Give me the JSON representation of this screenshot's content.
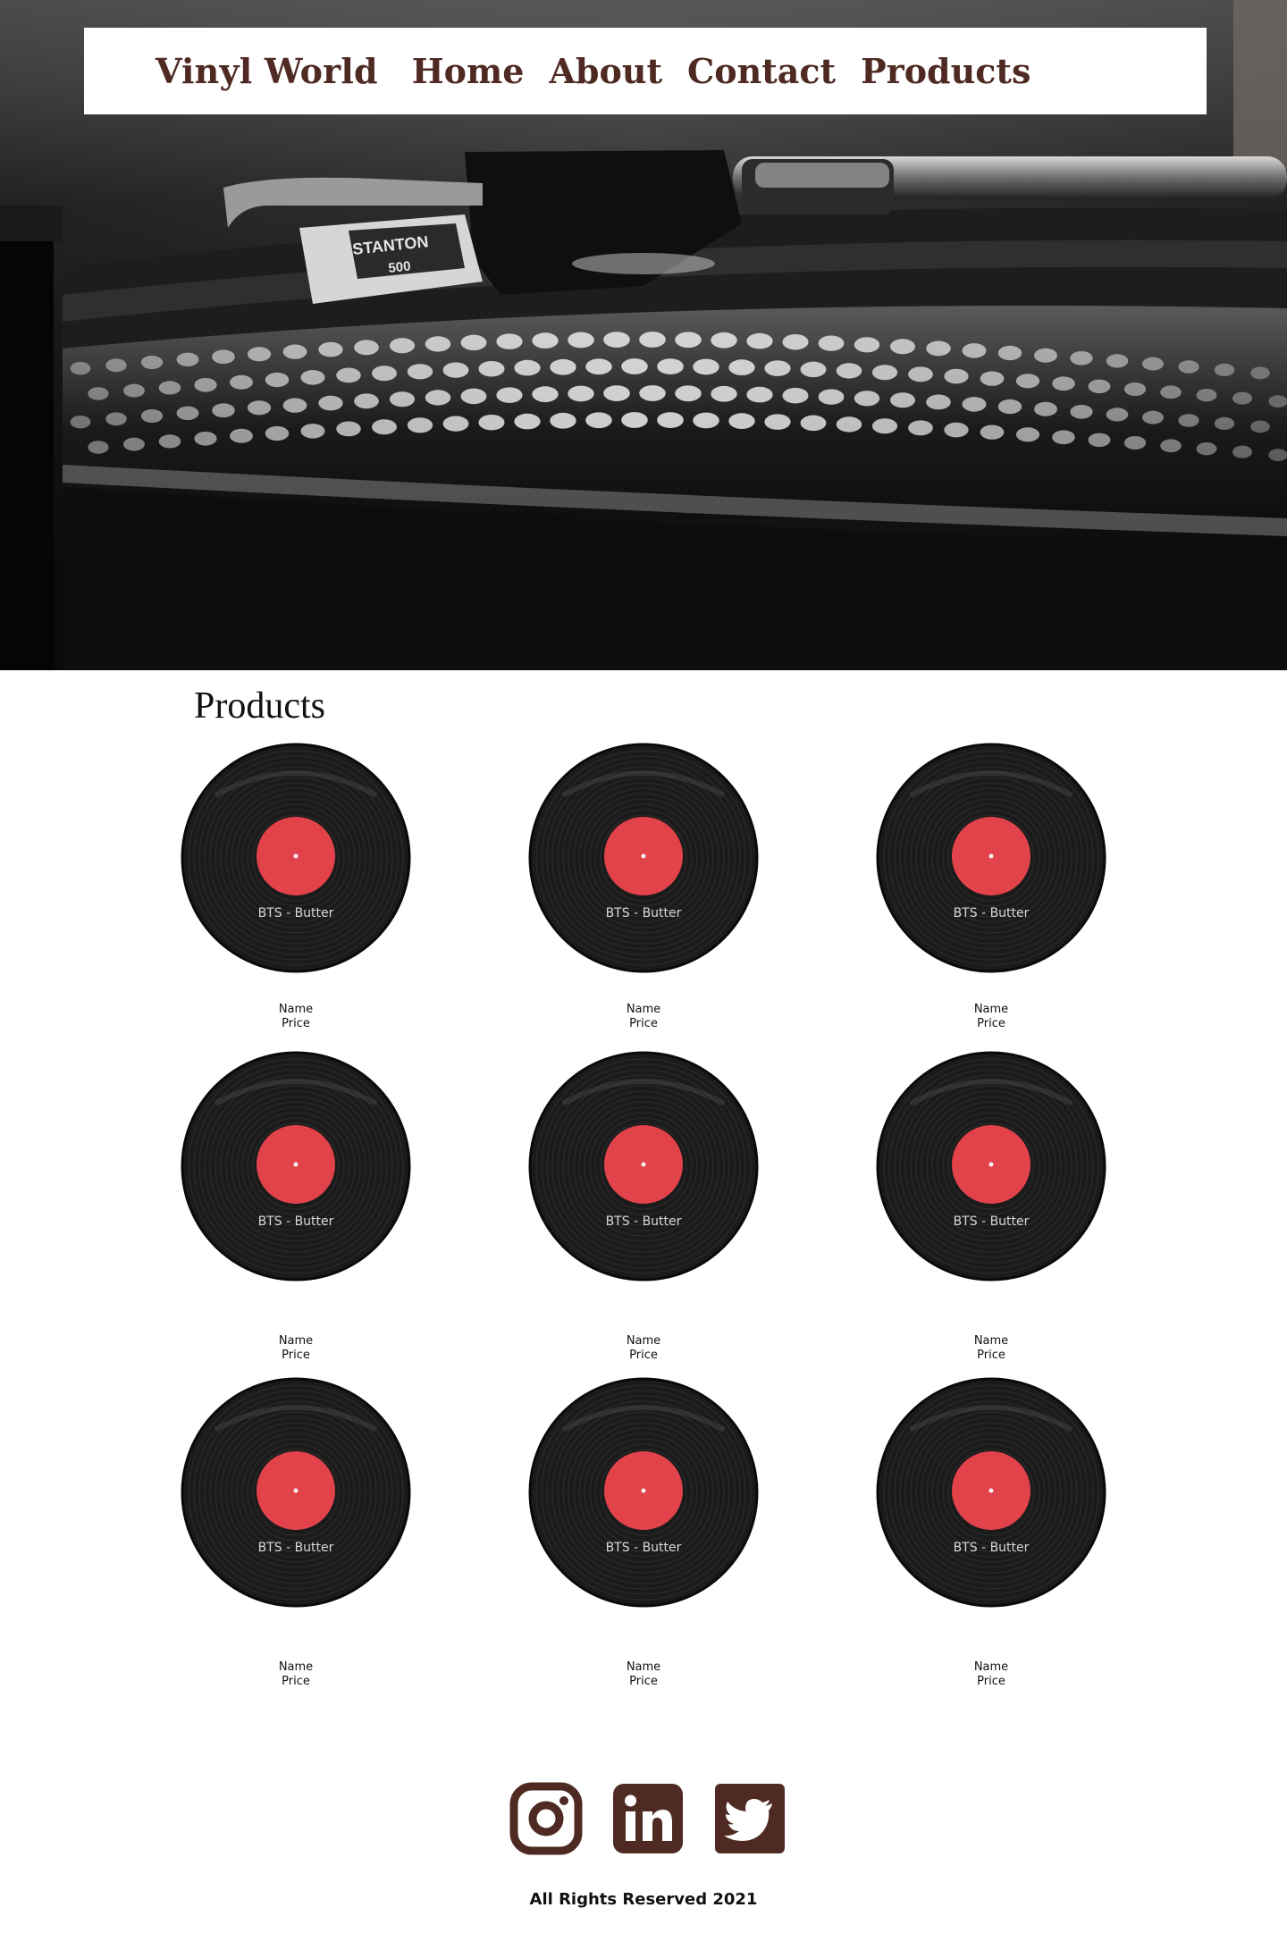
{
  "nav": {
    "brand": "Vinyl World",
    "links": [
      "Home",
      "About",
      "Contact",
      "Products"
    ]
  },
  "hero": {
    "image_alt": "Turntable close-up",
    "cartridge_brand": "STANTON",
    "cartridge_model": "500"
  },
  "products": {
    "title": "Products",
    "items": [
      {
        "record_label": "BTS - Butter",
        "name": "Name",
        "price": "Price"
      },
      {
        "record_label": "BTS - Butter",
        "name": "Name",
        "price": "Price"
      },
      {
        "record_label": "BTS - Butter",
        "name": "Name",
        "price": "Price"
      },
      {
        "record_label": "BTS - Butter",
        "name": "Name",
        "price": "Price"
      },
      {
        "record_label": "BTS - Butter",
        "name": "Name",
        "price": "Price"
      },
      {
        "record_label": "BTS - Butter",
        "name": "Name",
        "price": "Price"
      },
      {
        "record_label": "BTS - Butter",
        "name": "Name",
        "price": "Price"
      },
      {
        "record_label": "BTS - Butter",
        "name": "Name",
        "price": "Price"
      },
      {
        "record_label": "BTS - Butter",
        "name": "Name",
        "price": "Price"
      }
    ]
  },
  "footer": {
    "social_icons": [
      "instagram-icon",
      "linkedin-icon",
      "twitter-icon"
    ],
    "copyright": "All Rights Reserved 2021"
  },
  "colors": {
    "brand": "#4e2a22",
    "record_label": "#e2424a",
    "vinyl": "#1b1b1b"
  }
}
